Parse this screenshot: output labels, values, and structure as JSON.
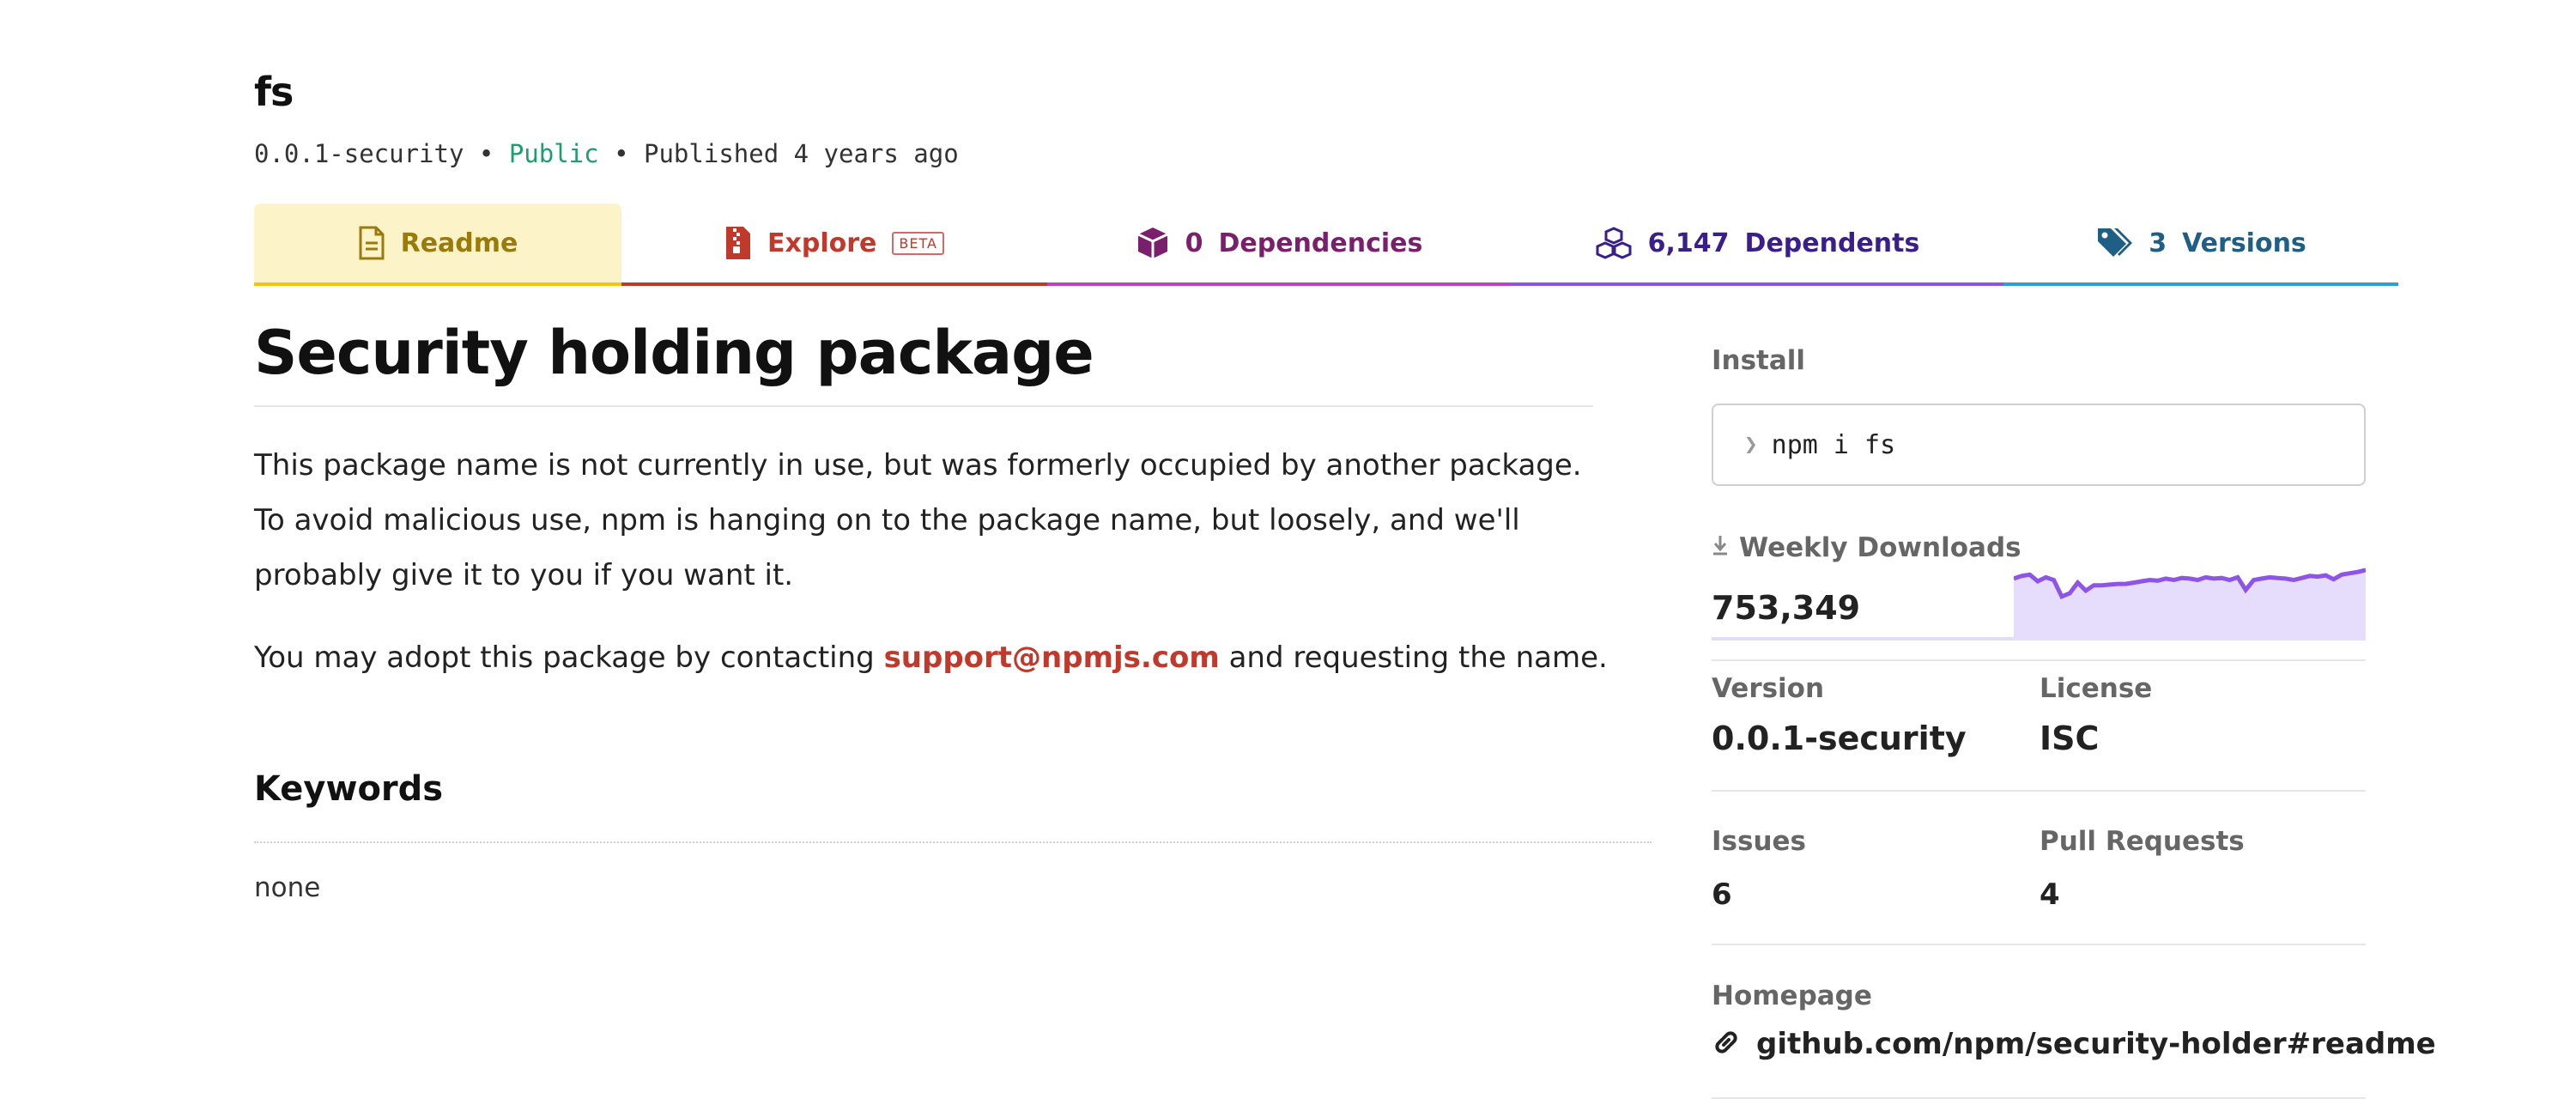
{
  "package": {
    "name": "fs",
    "version": "0.0.1-security",
    "visibility": "Public",
    "published": "Published 4 years ago",
    "separator": "•"
  },
  "tabs": {
    "readme": "Readme",
    "explore": "Explore",
    "explore_badge": "BETA",
    "dependencies_count": "0",
    "dependencies": "Dependencies",
    "dependents_count": "6,147",
    "dependents": "Dependents",
    "versions_count": "3",
    "versions": "Versions"
  },
  "readme": {
    "title": "Security holding package",
    "p1": "This package name is not currently in use, but was formerly occupied by another package. To avoid malicious use, npm is hanging on to the package name, but loosely, and we'll probably give it to you if you want it.",
    "p2_before": "You may adopt this package by contacting ",
    "p2_link": "support@npmjs.com",
    "p2_after": " and requesting the name.",
    "keywords_heading": "Keywords",
    "keywords_value": "none"
  },
  "sidebar": {
    "install_label": "Install",
    "install_command": "npm i fs",
    "install_prompt": "❯",
    "downloads_label": "Weekly Downloads",
    "downloads_value": "753,349",
    "version_label": "Version",
    "version_value": "0.0.1-security",
    "license_label": "License",
    "license_value": "ISC",
    "issues_label": "Issues",
    "issues_value": "6",
    "pulls_label": "Pull Requests",
    "pulls_value": "4",
    "homepage_label": "Homepage",
    "homepage_value": "github.com/npm/security-holder#readme"
  },
  "colors": {
    "readme_tab": "#f1c40f",
    "explore_tab": "#c0392b",
    "dependencies_tab": "#c03fc6",
    "dependents_tab": "#8e54e9",
    "versions_tab": "#2a9fd8",
    "sparkline_stroke": "#8e54e9",
    "sparkline_fill": "#e6dcfb",
    "link": "#c0392b"
  },
  "icons": {
    "readme": "document-icon",
    "explore": "zip-file-icon",
    "dependencies": "box-icon",
    "dependents": "boxes-icon",
    "versions": "tags-icon",
    "downloads": "download-icon",
    "homepage": "link-icon",
    "install": "prompt-icon"
  },
  "downloads_trend": [
    0.82,
    0.86,
    0.88,
    0.78,
    0.84,
    0.8,
    0.55,
    0.6,
    0.76,
    0.64,
    0.72,
    0.72,
    0.73,
    0.74,
    0.74,
    0.76,
    0.78,
    0.8,
    0.79,
    0.82,
    0.8,
    0.83,
    0.82,
    0.8,
    0.84,
    0.82,
    0.83,
    0.8,
    0.84,
    0.65,
    0.8,
    0.82,
    0.84,
    0.83,
    0.82,
    0.8,
    0.83,
    0.86,
    0.85,
    0.87,
    0.81,
    0.88,
    0.9,
    0.92,
    0.95
  ]
}
